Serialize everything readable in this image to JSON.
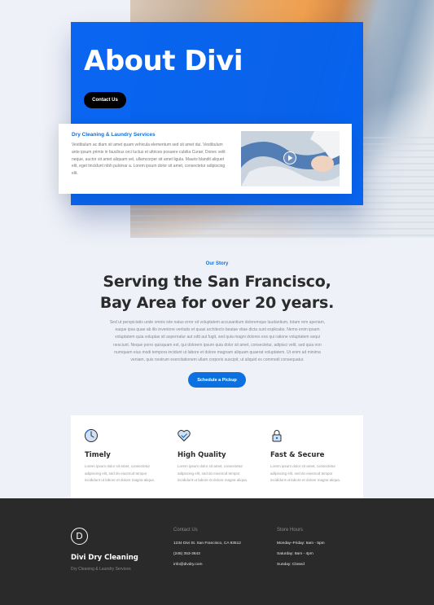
{
  "hero": {
    "title": "About Divi",
    "button_label": "Contact Us"
  },
  "service_card": {
    "title": "Dry Cleaning & Laundry Services",
    "body": "Vestibulum ac diam sit amet quam vehicula elementum sed sit amet dui. Vestibulum ante ipsum primis in faucibus orci luctus et ultrices posuere cubilia Curae; Donec velit neque, auctor sit amet aliquam vel, ullamcorper sit amet ligula. Mauris blandit aliquet elit, eget tincidunt nibh pulvinar a. Lorem ipsum dolor sit amet, consectetur adipiscing elit.",
    "video_icon": "play-icon"
  },
  "story": {
    "kicker": "Our Story",
    "heading_line1": "Serving the San Francisco,",
    "heading_line2": "Bay Area for over 20 years.",
    "body": "Sed ut perspiciatis unde omnis iste natus error sit voluptatem accusantium doloremque laudantium, totam rem aperiam, eaque ipsa quae ab illo inventore veritatis et quasi architecto beatae vitae dicta sunt explicabo. Nemo enim ipsam voluptatem quia voluptas sit aspernatur aut odit aut fugit, sed quia magni dolores eos qui ratione voluptatem sequi nesciunt. Neque porro quisquam est, qui dolorem ipsum quia dolor sit amet, consectetur, adipisci velit, sed quia non numquam eius modi tempora incidunt ut labore et dolore magnam aliquam quaerat voluptatem. Ut enim ad minima veniam, quis nostrum exercitationem ullam corporis suscipit, ut aliquid ex commodi consequatur.",
    "button_label": "Schedule a Pickup"
  },
  "features": [
    {
      "icon": "clock-icon",
      "title": "Timely",
      "text": "Lorem ipsum dolor sit amet, consectetur adipiscing elit, sed do eiusmod tempor incididunt ut labore et dolore magna aliqua."
    },
    {
      "icon": "heart-check-icon",
      "title": "High Quality",
      "text": "Lorem ipsum dolor sit amet, consectetur adipiscing elit, sed do eiusmod tempor incididunt ut labore et dolore magna aliqua."
    },
    {
      "icon": "lock-icon",
      "title": "Fast & Secure",
      "text": "Lorem ipsum dolor sit amet, consectetur adipiscing elit, sed do eiusmod tempor incididunt ut labore et dolore magna aliqua."
    }
  ],
  "footer": {
    "logo_letter": "D",
    "brand": "Divi Dry Cleaning",
    "tagline": "Dry Cleaning & Laundry Services",
    "contact": {
      "heading": "Contact Us",
      "address": "1234 Divi St. San Francisco, CA 93512",
      "phone": "(245) 353-3643",
      "email": "info@divdry.com"
    },
    "hours": {
      "heading": "Store Hours",
      "weekdays": "Monday–Friday: 6am - 5pm",
      "saturday": "Saturday: 8am - 4pm",
      "sunday": "Sunday: Closed"
    }
  },
  "colors": {
    "accent": "#0c71e0",
    "hero_blue": "#0060f0",
    "footer_bg": "#2a2a2a",
    "page_bg": "#eef1f8"
  }
}
